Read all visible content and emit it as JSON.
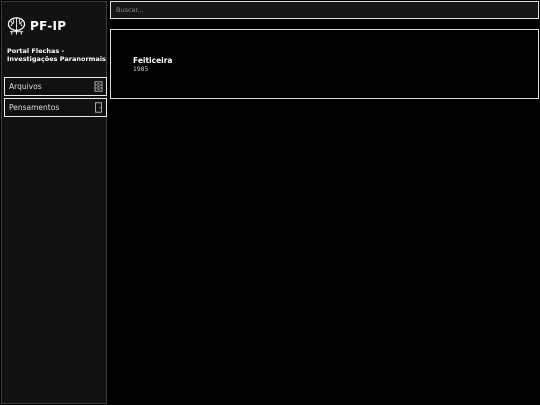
{
  "brand": {
    "name": "PF-IP",
    "logo_icon": "brain-icon"
  },
  "organization": "Portal Flechas - Investigações Paranormais",
  "nav": [
    {
      "label": "Arquivos",
      "icon": "archive-box-icon"
    },
    {
      "label": "Pensamentos",
      "icon": "door-icon"
    }
  ],
  "search": {
    "placeholder": "Buscar...",
    "value": ""
  },
  "results": [
    {
      "title": "Feiticeira",
      "year": "1985"
    }
  ]
}
